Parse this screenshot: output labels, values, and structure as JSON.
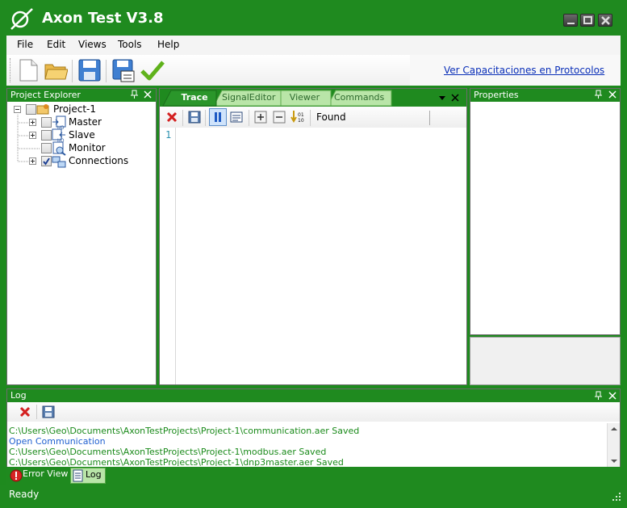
{
  "window": {
    "title": "Axon Test V3.8"
  },
  "menu": {
    "items": [
      "File",
      "Edit",
      "Views",
      "Tools",
      "Help"
    ]
  },
  "toolbar": {
    "link_label": "Ver Capacitaciones en Protocolos",
    "icons": [
      "new-file-icon",
      "open-folder-icon",
      "save-icon",
      "save-as-icon",
      "validate-check-icon"
    ]
  },
  "project_explorer": {
    "title": "Project Explorer",
    "root": "Project-1",
    "nodes": [
      {
        "label": "Master",
        "checked": false,
        "expandable": true
      },
      {
        "label": "Slave",
        "checked": false,
        "expandable": true
      },
      {
        "label": "Monitor",
        "checked": false,
        "expandable": false
      },
      {
        "label": "Connections",
        "checked": true,
        "expandable": true
      }
    ]
  },
  "documents": {
    "tabs": [
      "Trace",
      "SignalEditor",
      "Viewer",
      "Commands"
    ],
    "active_tab": "Trace",
    "toolbar_found_label": "Found",
    "line_numbers": [
      "1"
    ]
  },
  "properties": {
    "title": "Properties"
  },
  "log": {
    "title": "Log",
    "lines": [
      {
        "text": "C:\\Users\\Geo\\Documents\\AxonTestProjects\\Project-1\\communication.aer Saved",
        "color": "#1a8a1a"
      },
      {
        "text": "Open Communication",
        "color": "#1f5fd0"
      },
      {
        "text": "C:\\Users\\Geo\\Documents\\AxonTestProjects\\Project-1\\modbus.aer Saved",
        "color": "#1a8a1a"
      },
      {
        "text": "C:\\Users\\Geo\\Documents\\AxonTestProjects\\Project-1\\dnp3master.aer Saved",
        "color": "#1a8a1a"
      }
    ]
  },
  "bottom_tabs": {
    "error_view": "Error View",
    "log": "Log"
  },
  "status": {
    "text": "Ready"
  },
  "colors": {
    "brand_green": "#1f8a1f",
    "tab_light_green": "#b9e5a8",
    "link_blue": "#0a2fb8"
  }
}
